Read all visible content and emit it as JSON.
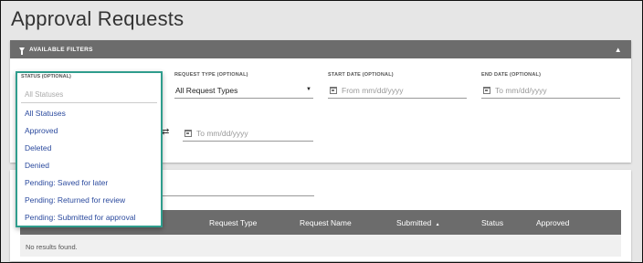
{
  "page": {
    "title": "Approval Requests"
  },
  "filters": {
    "header_label": "AVAILABLE FILTERS",
    "status": {
      "label": "STATUS (OPTIONAL)",
      "placeholder": "All Statuses",
      "options": [
        "All Statuses",
        "Approved",
        "Deleted",
        "Denied",
        "Pending: Saved for later",
        "Pending: Returned for review",
        "Pending: Submitted for approval"
      ]
    },
    "request_type": {
      "label": "REQUEST TYPE (OPTIONAL)",
      "value": "All Request Types"
    },
    "start_date": {
      "label": "START DATE (OPTIONAL)",
      "placeholder": "From mm/dd/yyyy"
    },
    "end_date": {
      "label": "END DATE (OPTIONAL)",
      "placeholder": "To mm/dd/yyyy"
    },
    "range_to": {
      "placeholder": "To mm/dd/yyyy"
    }
  },
  "table": {
    "columns": [
      "Request Type",
      "Request Name",
      "Submitted",
      "Status",
      "Approved"
    ],
    "sort_indicator": "▲",
    "empty_message": "No results found."
  }
}
